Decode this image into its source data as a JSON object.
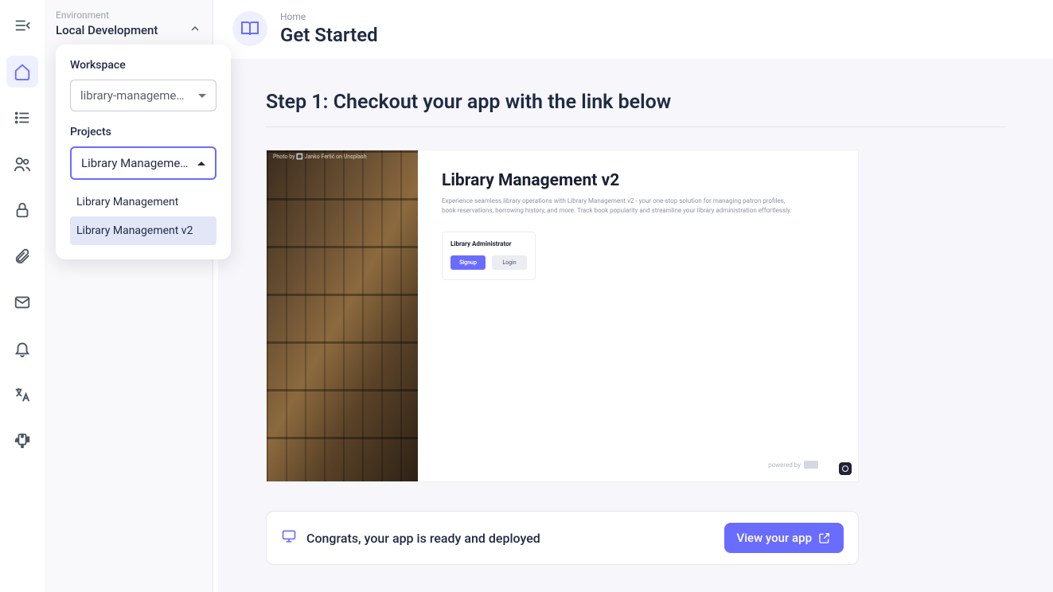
{
  "sidebar_rail": {
    "items": [
      {
        "name": "menu-collapse-icon"
      },
      {
        "name": "home-icon"
      },
      {
        "name": "list-icon"
      },
      {
        "name": "users-icon"
      },
      {
        "name": "lock-icon"
      },
      {
        "name": "attachment-icon"
      },
      {
        "name": "mail-icon"
      },
      {
        "name": "bell-icon"
      },
      {
        "name": "language-icon"
      },
      {
        "name": "plugin-icon"
      }
    ]
  },
  "environment": {
    "label": "Environment",
    "name": "Local Development"
  },
  "dropdown": {
    "workspace_label": "Workspace",
    "workspace_value": "library-manageme…",
    "projects_label": "Projects",
    "projects_value": "Library Manageme…",
    "options": [
      {
        "label": "Library Management",
        "selected": false
      },
      {
        "label": "Library Management v2",
        "selected": true
      }
    ]
  },
  "header": {
    "breadcrumb": "Home",
    "title": "Get Started"
  },
  "content": {
    "step_title": "Step 1: Checkout your app with the link below",
    "preview": {
      "photo_credit": "Photo by 🔳 Janko Ferlič on Unsplash",
      "title": "Library Management v2",
      "description": "Experience seamless library operations with Library Management v2 - your one-stop solution for managing patron profiles, book reservations, borrowing history, and more. Track book popularity and streamline your library administration effortlessly.",
      "admin_title": "Library Administrator",
      "signup": "Signup",
      "login": "Login",
      "powered_by": "powered by"
    },
    "congrats": "Congrats, your app is ready and deployed",
    "view_button": "View your app"
  }
}
